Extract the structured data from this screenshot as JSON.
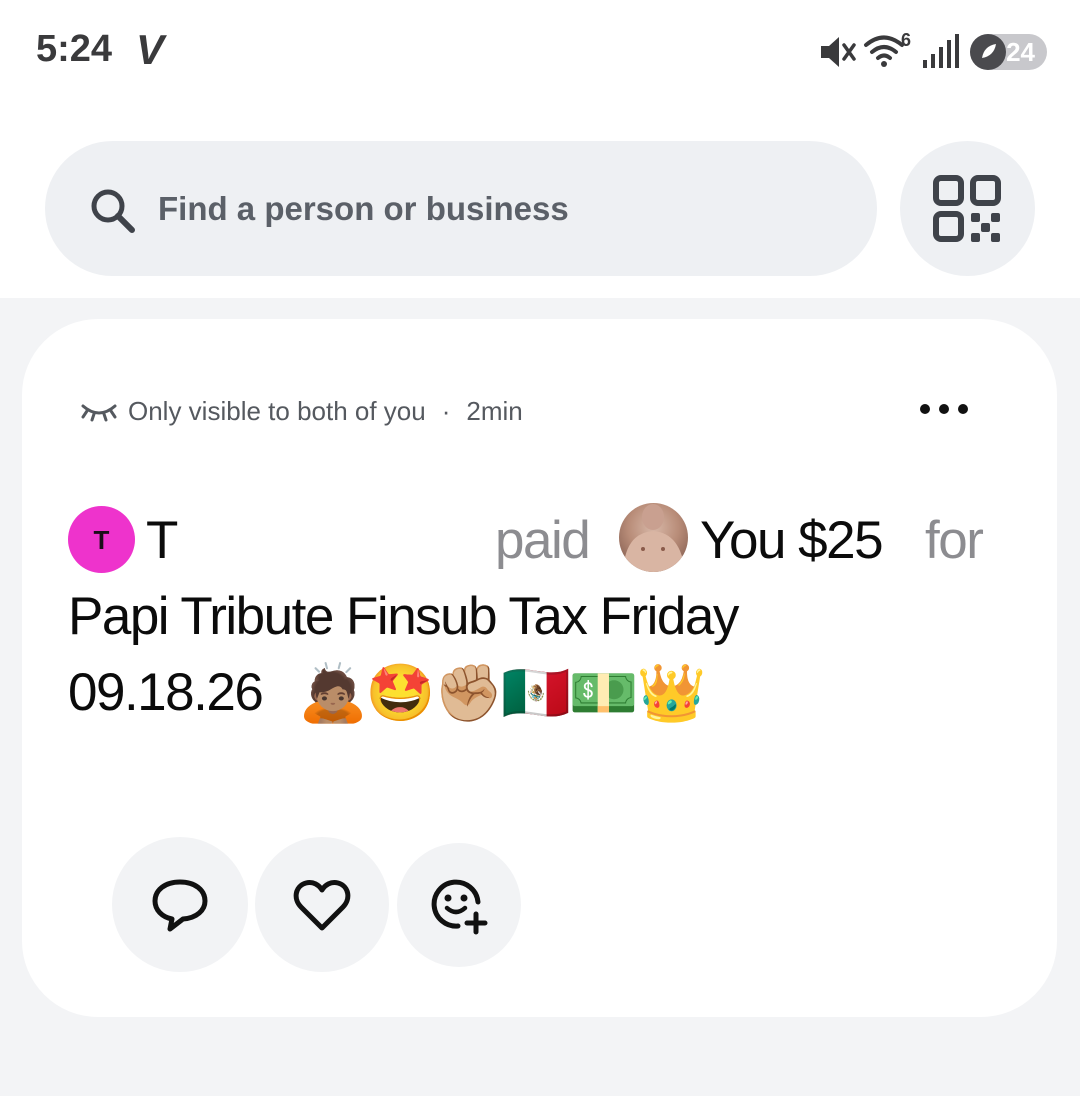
{
  "status_bar": {
    "time": "5:24",
    "app_badge": "V",
    "wifi_badge": "6",
    "battery_level": "24"
  },
  "search": {
    "placeholder": "Find a person or business"
  },
  "feed": {
    "story": {
      "visibility": "Only visible to both of you",
      "separator": "·",
      "time_ago": "2min",
      "payer_initial": "T",
      "payer_name": "T",
      "verb": "paid",
      "payee": "You",
      "amount": "$25",
      "for_word": "for",
      "note_line1": "Papi Tribute Finsub Tax Friday",
      "note_line2": "09.18.26",
      "note_emojis": "🙇🏽🤩✊🏼🇲🇽💵👑"
    }
  },
  "colors": {
    "avatar_pink": "#ee33cc",
    "card_bg": "#ffffff",
    "page_bg": "#f3f4f6",
    "search_bg": "#eef0f3"
  }
}
